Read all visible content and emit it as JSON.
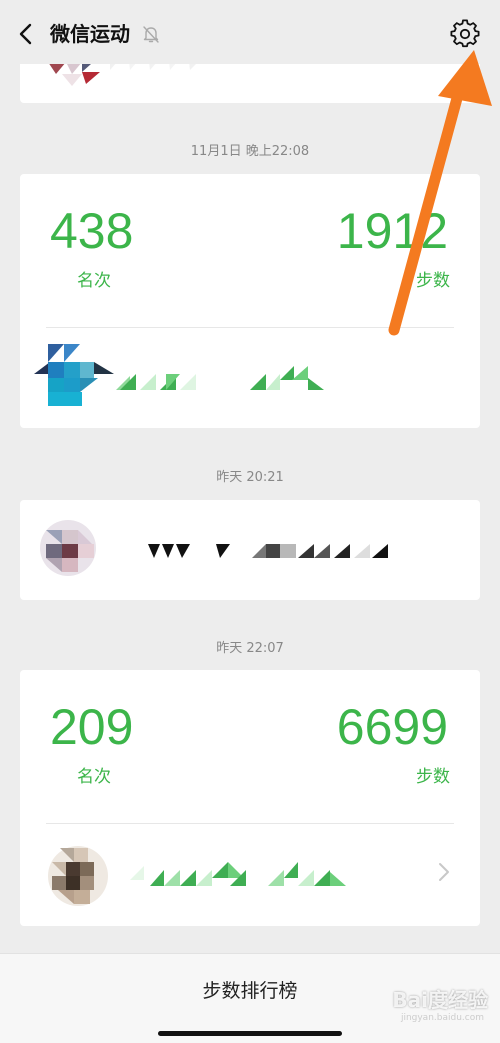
{
  "header": {
    "title": "微信运动",
    "back_icon": "chevron-left-icon",
    "mute_icon": "bell-off-icon",
    "settings_icon": "gear-icon"
  },
  "feed": [
    {
      "timestamp": ""
    },
    {
      "timestamp": "11月1日 晚上22:08",
      "rank": "438",
      "rank_label": "名次",
      "steps": "1912",
      "steps_label": "步数"
    },
    {
      "timestamp": "昨天 20:21"
    },
    {
      "timestamp": "昨天 22:07",
      "rank": "209",
      "rank_label": "名次",
      "steps": "6699",
      "steps_label": "步数"
    }
  ],
  "bottom_bar": {
    "label": "步数排行榜"
  },
  "watermark": {
    "text": "Bai度经验",
    "sub": "jingyan.baidu.com"
  },
  "colors": {
    "accent_green": "#3cb54a",
    "annotation_arrow": "#f47a20",
    "background": "#ededed"
  }
}
